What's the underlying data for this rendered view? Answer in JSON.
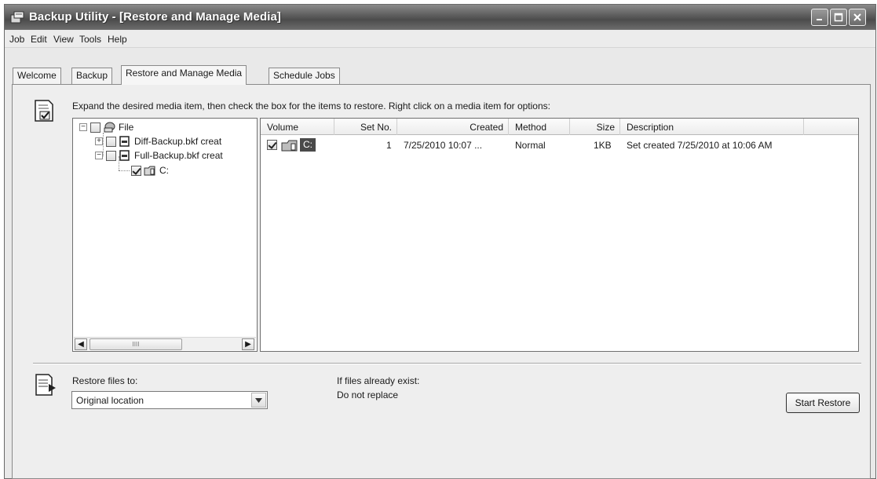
{
  "window": {
    "title": "Backup Utility - [Restore and Manage Media]"
  },
  "menu": [
    "Job",
    "Edit",
    "View",
    "Tools",
    "Help"
  ],
  "tabs": [
    "Welcome",
    "Backup",
    "Restore and Manage Media",
    "Schedule Jobs"
  ],
  "active_tab": "Restore and Manage Media",
  "instruction": "Expand the desired media item, then check the box for the items to restore. Right click on a media item for options:",
  "tree": {
    "root": "File",
    "items": [
      "Diff-Backup.bkf creat",
      "Full-Backup.bkf creat"
    ],
    "child": "C:"
  },
  "list": {
    "columns": [
      "Volume",
      "Set No.",
      "Created",
      "Method",
      "Size",
      "Description"
    ],
    "rows": [
      {
        "volume": "C:",
        "set_no": "1",
        "created": "7/25/2010 10:07 ...",
        "method": "Normal",
        "size": "1KB",
        "description": "Set created 7/25/2010 at 10:06 AM",
        "checked": true
      }
    ]
  },
  "restore": {
    "label": "Restore files to:",
    "value": "Original location"
  },
  "existing": {
    "label": "If files already exist:",
    "value": "Do not replace"
  },
  "buttons": {
    "start_restore": "Start Restore"
  },
  "scrollbar": {
    "thumb_grip": "IIII"
  }
}
